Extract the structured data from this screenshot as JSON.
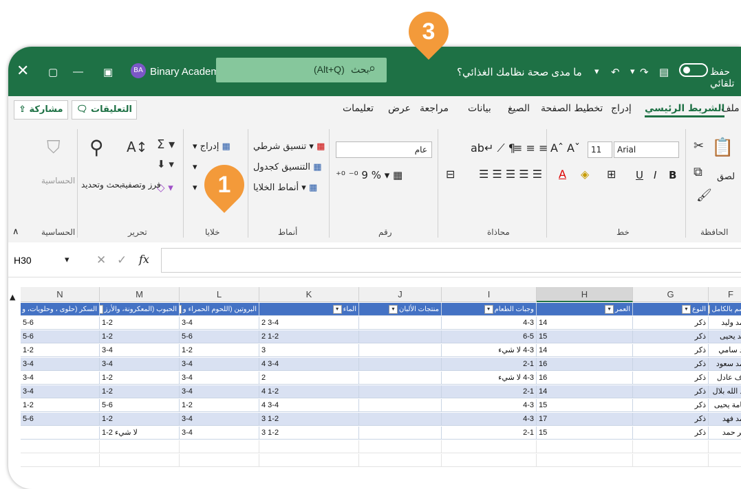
{
  "titlebar": {
    "app_name": "Binary Academy",
    "avatar": "BA",
    "search_label": "بحث (Alt+Q)",
    "search_text": "بحث",
    "search_shortcut": "(Alt+Q)",
    "doc_title": "ما مدى صحة نظامك الغذائي؟",
    "autosave": "حفظ تلقائي"
  },
  "tabs": [
    "ملف",
    "الشريط الرئيسي",
    "إدراج",
    "تخطيط الصفحة",
    "الصيغ",
    "بيانات",
    "مراجعة",
    "عرض",
    "تعليمات"
  ],
  "share_label": "مشاركة",
  "comments_label": "التعليقات",
  "ribbon": {
    "groups": {
      "clipboard": "الحافظة",
      "font": "خط",
      "alignment": "محاذاة",
      "number": "رقم",
      "styles": "أنماط",
      "cells": "خلايا",
      "editing": "تحرير",
      "sensitivity": "الحساسية"
    },
    "paste": "لصق",
    "font_name": "Arial",
    "font_size": "11",
    "number_format": "عام",
    "cond_format": "تنسيق شرطي",
    "format_table": "التنسيق كجدول",
    "cell_styles": "أنماط الخلايا",
    "insert": "إدراج",
    "sort_filter": "فرز وتصفية",
    "find_select": "بحث وتحديد",
    "sensitivity_btn": "الحساسية"
  },
  "formula_bar": {
    "name_box": "H30",
    "fx": "fx"
  },
  "columns": [
    "F",
    "G",
    "H",
    "I",
    "J",
    "K",
    "L",
    "M",
    "N"
  ],
  "selected_column": "H",
  "headers": [
    "الإسم بالكامل",
    "النوع",
    "العمر",
    "وجبات الطعام",
    "منتجات الألبان",
    "الماء",
    "البروتين (اللحوم الحمراء و",
    "الحبوب (المعكرونة، والأرز",
    "السكر (حلوى ، وحلويات، و"
  ],
  "rows": [
    [
      "أحمد وليد",
      "ذكر",
      "14",
      "4-3",
      "",
      "2 3-4",
      "3-4",
      "1-2",
      "5-6"
    ],
    [
      "خالد يحيى",
      "ذكر",
      "15",
      "6-5",
      "",
      "2 1-2",
      "5-6",
      "1-2",
      "5-6"
    ],
    [
      "فهد سامي",
      "ذكر",
      "14",
      "4-3 لا شيء",
      "",
      "3",
      "1-2",
      "3-4",
      "1-2"
    ],
    [
      "أحمد سعود",
      "ذكر",
      "16",
      "2-1",
      "",
      "4 3-4",
      "3-4",
      "3-4",
      "3-4"
    ],
    [
      "نواف عادل",
      "ذكر",
      "16",
      "4-3 لا شيء",
      "",
      "2",
      "3-4",
      "1-2",
      "3-4"
    ],
    [
      "عبد الله بلال",
      "ذكر",
      "14",
      "2-1",
      "",
      "4 1-2",
      "3-4",
      "1-2",
      "3-4"
    ],
    [
      "أسامة يحيى",
      "ذكر",
      "15",
      "4-3",
      "",
      "4 3-4",
      "1-2",
      "5-6",
      "1-2"
    ],
    [
      "أحمد فهد",
      "ذكر",
      "17",
      "4-3",
      "",
      "3 1-2",
      "3-4",
      "1-2",
      "5-6"
    ],
    [
      "جابر حمد",
      "ذكر",
      "15",
      "2-1",
      "",
      "3 1-2",
      "3-4",
      "1-2 لا شيء",
      ""
    ]
  ],
  "badges": {
    "one": "1",
    "three": "3"
  }
}
